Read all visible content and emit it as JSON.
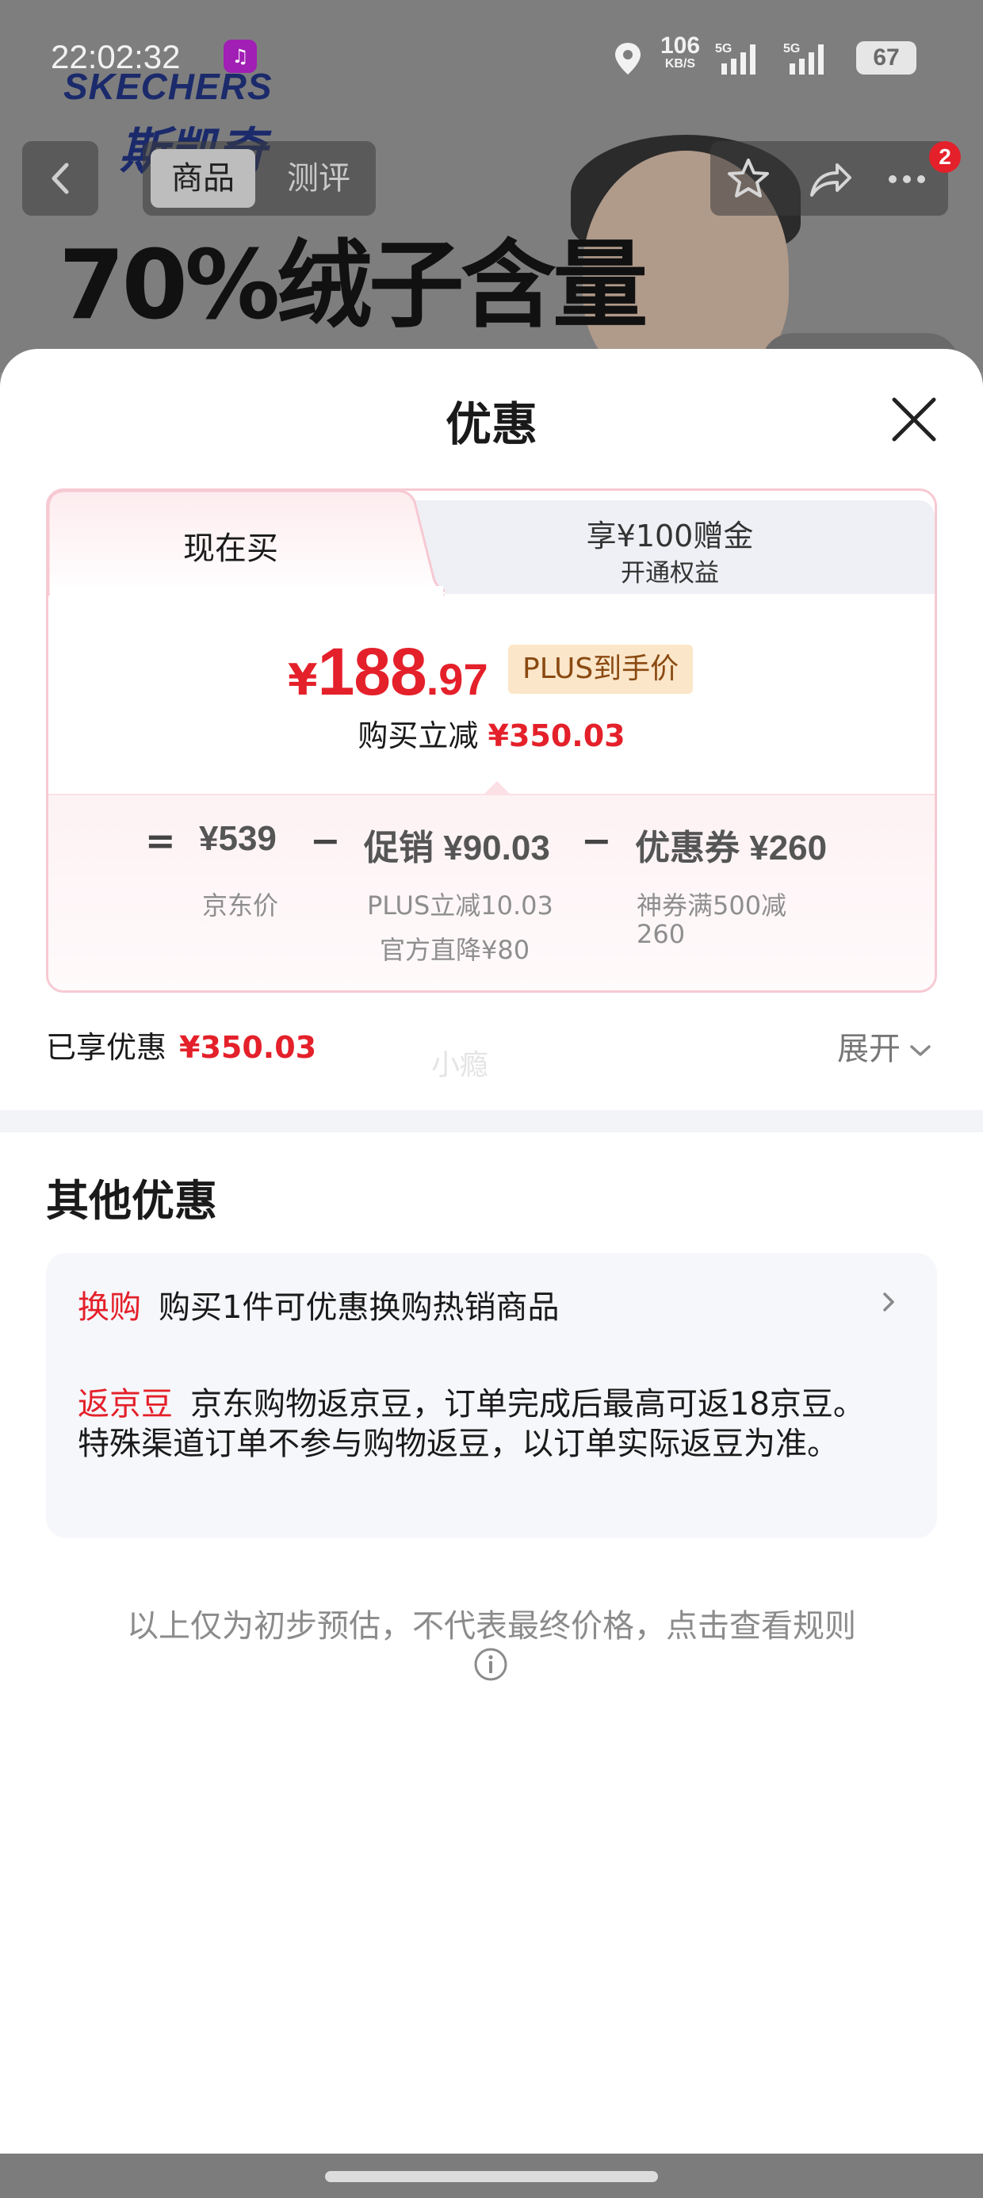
{
  "status_bar": {
    "time": "22:02:32",
    "net_speed": "106",
    "net_unit": "KB/S",
    "signal1": "5G",
    "signal2": "5G",
    "battery": "67"
  },
  "background": {
    "brand_en": "SKECHERS",
    "brand_cn": "斯凯奇",
    "headline": "70%绒子含量"
  },
  "nav": {
    "tab_product": "商品",
    "tab_review": "测评",
    "cart_badge": "2"
  },
  "sheet": {
    "title": "优惠"
  },
  "card": {
    "tab_now": "现在买",
    "tab_plus_line1": "享¥100赠金",
    "tab_plus_line2": "开通权益",
    "price_currency": "¥",
    "price_integer": "188",
    "price_decimal": ".97",
    "plus_tag": "PLUS到手价",
    "reduce_label": "购买立减",
    "reduce_value": "¥350.03"
  },
  "formula": {
    "eq": "=",
    "jd_price": "¥539",
    "jd_price_label": "京东价",
    "minus1": "−",
    "promo": "促销 ¥90.03",
    "promo_detail1": "PLUS立减10.03",
    "promo_detail2": "官方直降¥80",
    "minus2": "−",
    "coupon": "优惠券 ¥260",
    "coupon_detail1": "神券满500减",
    "coupon_detail2": "260"
  },
  "summary": {
    "enjoyed_label": "已享优惠",
    "enjoyed_value": "¥350.03",
    "watermark": "小瘾",
    "expand": "展开"
  },
  "other": {
    "title": "其他优惠",
    "item1_tag": "换购",
    "item1_text": "购买1件可优惠换购热销商品",
    "item2_tag": "返京豆",
    "item2_text": "京东购物返京豆，订单完成后最高可返18京豆。特殊渠道订单不参与购物返豆，以订单实际返豆为准。"
  },
  "footer": {
    "rule_note": "以上仅为初步预估，不代表最终价格，点击查看规则"
  },
  "colors": {
    "accent_red": "#e4202a",
    "card_border": "#f7c9d2",
    "plus_tag_bg": "#fbe6c9"
  }
}
